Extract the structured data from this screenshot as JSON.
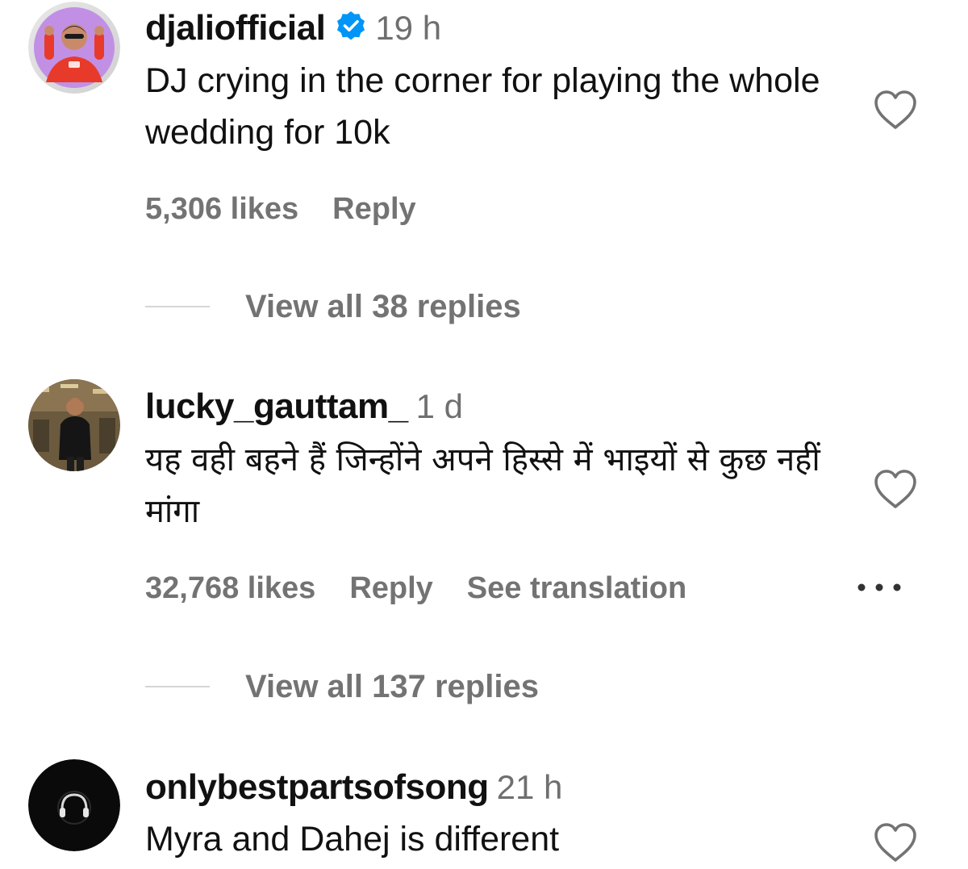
{
  "comments": [
    {
      "username": "djaliofficial",
      "verified": true,
      "time": "19 h",
      "text": "DJ crying in the corner for playing the whole wedding for 10k",
      "likes": "5,306 likes",
      "reply": "Reply",
      "view_replies": "View all 38 replies"
    },
    {
      "username": "lucky_gauttam_",
      "verified": false,
      "time": "1 d",
      "text": "यह वही बहने हैं जिन्होंने अपने हिस्से में भाइयों से कुछ नहीं मांगा",
      "likes": "32,768 likes",
      "reply": "Reply",
      "see_translation": "See translation",
      "view_replies": "View all 137 replies"
    },
    {
      "username": "onlybestpartsofsong",
      "verified": false,
      "time": "21 h",
      "text": "Myra and Dahej is different"
    }
  ],
  "icons": {
    "like": "heart-outline-icon",
    "more": "ellipsis-icon",
    "verified": "verified-badge-icon"
  },
  "colors": {
    "verified_blue": "#0095f6",
    "muted_text": "#737373",
    "primary_text": "#111111"
  }
}
